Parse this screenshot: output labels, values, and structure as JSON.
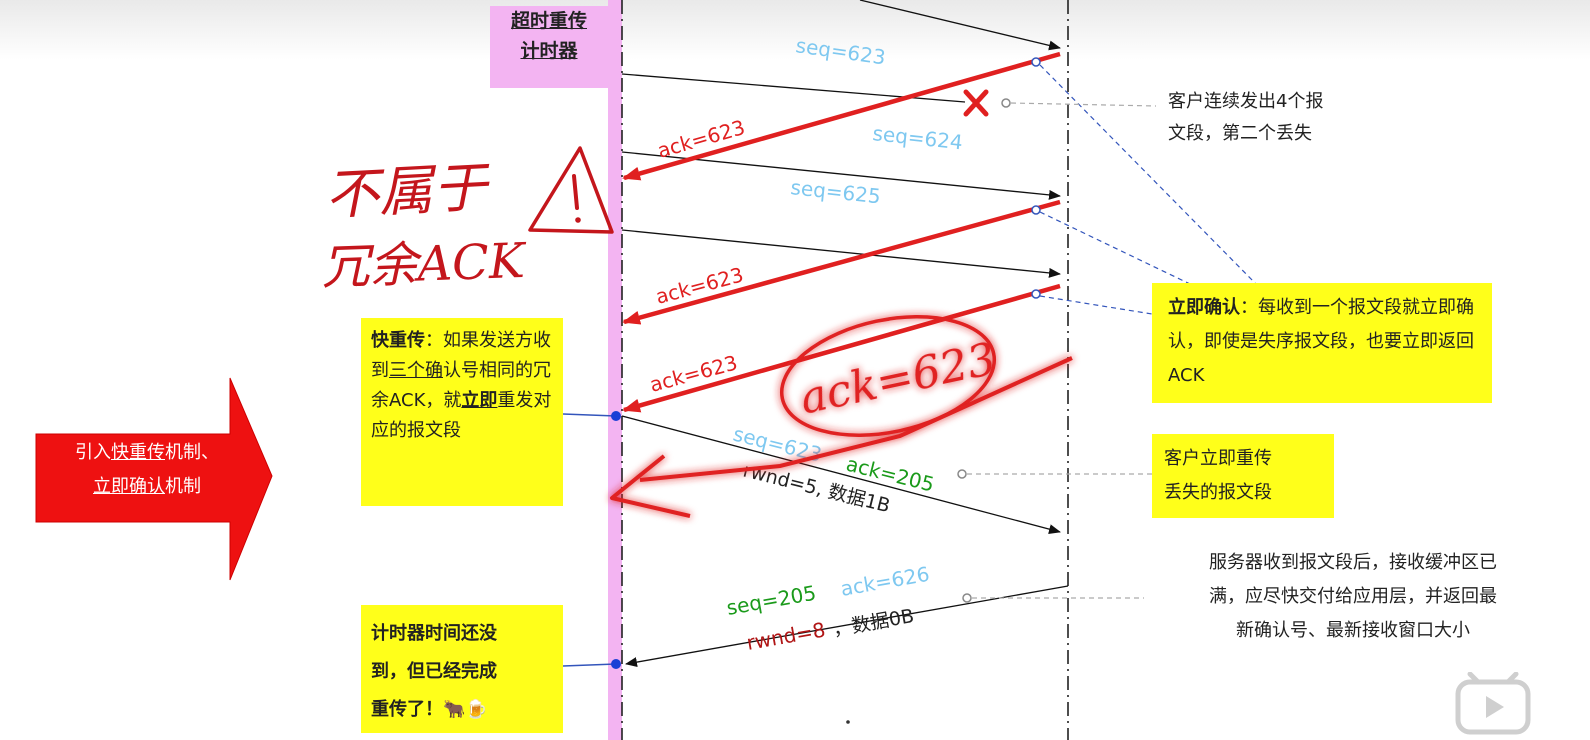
{
  "timer_label": {
    "line1": "超时重传",
    "line2": "计时器"
  },
  "intro_arrow": {
    "prefix": "引入",
    "fast": "快重传",
    "mid": "机制、",
    "immed": "立即确认",
    "suffix": "机制"
  },
  "handwriting": {
    "line1": "不属于",
    "line2": "冗余ACK",
    "circled": "ack=623"
  },
  "fast_retransmit": {
    "title": "快重传",
    "t1": "：如果发送方收到",
    "t2": "三个确",
    "t3": "认号相同的冗余ACK",
    "t4": "，就",
    "t5": "立即",
    "t6": "重发对应的报文段"
  },
  "timer_note": {
    "line1": "计时器时间还没",
    "line2": "到，但已经完成",
    "line3": "重传了！🐂🍺"
  },
  "immediate_ack": {
    "title": "立即确认",
    "body": "：每收到一个报文段就立即确认，即使是失序报文段，也要立即返回ACK"
  },
  "loss_note": {
    "line1": "客户连续发出4个报",
    "line2": "文段，第二个丢失"
  },
  "resend_note": {
    "line1": "客户立即重传",
    "line2": "丢失的报文段"
  },
  "server_note": {
    "line1": "服务器收到报文段后，接收缓冲区已",
    "line2": "满，应尽快交付给应用层，并返回最",
    "line3": "新确认号、最新接收窗口大小"
  },
  "messages": {
    "seq623": "seq=623",
    "seq624": "seq=624",
    "seq625": "seq=625",
    "ack623a": "ack=623",
    "ack623b": "ack=623",
    "ack623c": "ack=623",
    "resend_seq": "seq=623",
    "resend_ack": "ack=205",
    "resend_meta": "rwnd=5, 数据1B",
    "reply_seq": "seq=205",
    "reply_ack": "ack=626",
    "reply_rwnd": "rwnd=8",
    "reply_data": "，数据0B"
  },
  "colors": {
    "seq": "#7ec8f0",
    "ack_red": "#e02020",
    "green": "#1a9a1a",
    "dark_red": "#b01515",
    "highlight": "#ffff1a",
    "timer_bar": "#f3b4f2"
  }
}
